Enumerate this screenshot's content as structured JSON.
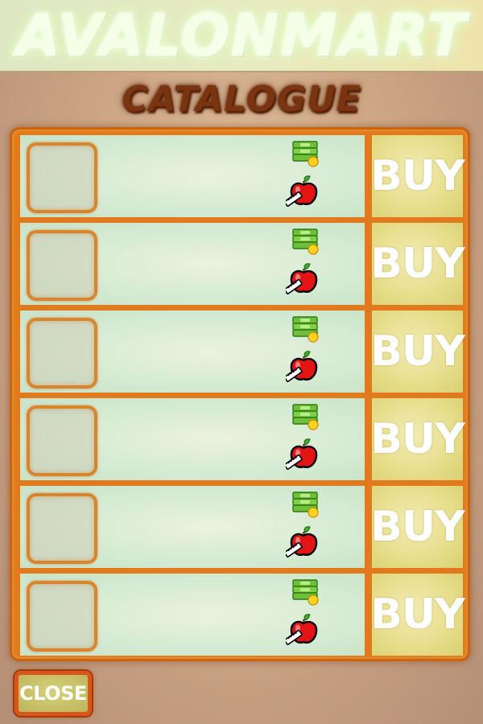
{
  "header": {
    "brand": "AVALONMART",
    "title": "CATALOGUE"
  },
  "catalogue": {
    "items": [
      {
        "price_icon": "cash-icon",
        "requirement_icon": "apple-icon",
        "buy_label": "BUY"
      },
      {
        "price_icon": "cash-icon",
        "requirement_icon": "apple-icon",
        "buy_label": "BUY"
      },
      {
        "price_icon": "cash-icon",
        "requirement_icon": "apple-icon",
        "buy_label": "BUY"
      },
      {
        "price_icon": "cash-icon",
        "requirement_icon": "apple-icon",
        "buy_label": "BUY"
      },
      {
        "price_icon": "cash-icon",
        "requirement_icon": "apple-icon",
        "buy_label": "BUY"
      },
      {
        "price_icon": "cash-icon",
        "requirement_icon": "apple-icon",
        "buy_label": "BUY"
      }
    ]
  },
  "footer": {
    "close_label": "CLOSE"
  },
  "colors": {
    "panel_border": "#e07a1c",
    "title": "#7a3410",
    "buy_background": "#e6dd8a",
    "row_background": "#d4ead2"
  }
}
